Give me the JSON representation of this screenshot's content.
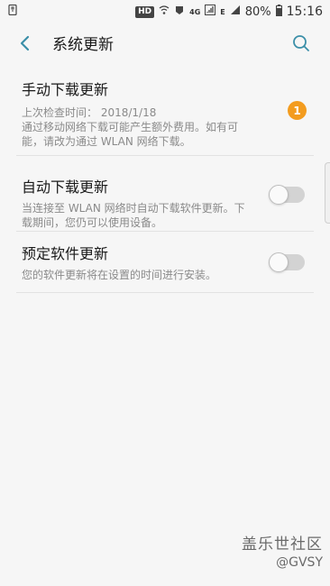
{
  "status_bar": {
    "hd": "HD",
    "network_4g": "4G",
    "network_e": "E",
    "battery": "80%",
    "time": "15:16"
  },
  "header": {
    "title": "系统更新",
    "back_icon": "arrow-back-icon",
    "search_icon": "search-icon"
  },
  "items": [
    {
      "title": "手动下载更新",
      "subtitle_line1": "上次检查时间：  2018/1/18",
      "subtitle_line2": "通过移动网络下载可能产生额外费用。如有可",
      "subtitle_line3": "能，请改为通过 WLAN 网络下载。",
      "badge": "1"
    },
    {
      "title": "自动下载更新",
      "subtitle_line1": "当连接至 WLAN 网络时自动下载软件更新。下",
      "subtitle_line2": "载期间，您仍可以使用设备。",
      "toggle_on": false
    },
    {
      "title": "预定软件更新",
      "subtitle_line1": "您的软件更新将在设置的时间进行安装。",
      "toggle_on": false
    }
  ],
  "watermark": {
    "line1": "盖乐世社区",
    "line2": "@GVSY"
  },
  "colors": {
    "accent": "#3b8fa8",
    "badge": "#f39c1f",
    "background": "#f6f6f6"
  }
}
